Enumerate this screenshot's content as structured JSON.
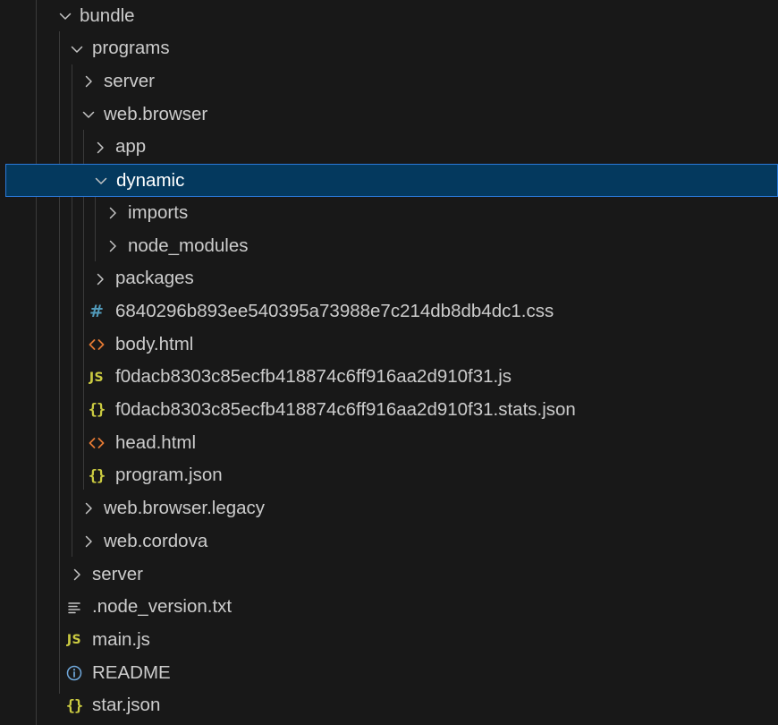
{
  "explorer": {
    "items": [
      {
        "label": "bundle",
        "kind": "folder",
        "expanded": true,
        "icon": "chevron-down-icon"
      },
      {
        "label": "programs",
        "kind": "folder",
        "expanded": true,
        "icon": "chevron-down-icon"
      },
      {
        "label": "server",
        "kind": "folder",
        "expanded": false,
        "icon": "chevron-right-icon"
      },
      {
        "label": "web.browser",
        "kind": "folder",
        "expanded": true,
        "icon": "chevron-down-icon"
      },
      {
        "label": "app",
        "kind": "folder",
        "expanded": false,
        "icon": "chevron-right-icon"
      },
      {
        "label": "dynamic",
        "kind": "folder",
        "expanded": true,
        "selected": true,
        "icon": "chevron-down-icon"
      },
      {
        "label": "imports",
        "kind": "folder",
        "expanded": false,
        "icon": "chevron-right-icon"
      },
      {
        "label": "node_modules",
        "kind": "folder",
        "expanded": false,
        "icon": "chevron-right-icon"
      },
      {
        "label": "packages",
        "kind": "folder",
        "expanded": false,
        "icon": "chevron-right-icon"
      },
      {
        "label": "6840296b893ee540395a73988e7c214db8db4dc1.css",
        "kind": "file",
        "icon": "css-hash-icon",
        "glyph": "#"
      },
      {
        "label": "body.html",
        "kind": "file",
        "icon": "html-brackets-icon"
      },
      {
        "label": "f0dacb8303c85ecfb418874c6ff916aa2d910f31.js",
        "kind": "file",
        "icon": "js-file-icon",
        "glyph": "JS"
      },
      {
        "label": "f0dacb8303c85ecfb418874c6ff916aa2d910f31.stats.json",
        "kind": "file",
        "icon": "json-braces-icon",
        "glyph": "{}"
      },
      {
        "label": "head.html",
        "kind": "file",
        "icon": "html-brackets-icon"
      },
      {
        "label": "program.json",
        "kind": "file",
        "icon": "json-braces-icon",
        "glyph": "{}"
      },
      {
        "label": "web.browser.legacy",
        "kind": "folder",
        "expanded": false,
        "icon": "chevron-right-icon"
      },
      {
        "label": "web.cordova",
        "kind": "folder",
        "expanded": false,
        "icon": "chevron-right-icon"
      },
      {
        "label": "server",
        "kind": "folder",
        "expanded": false,
        "icon": "chevron-right-icon"
      },
      {
        "label": ".node_version.txt",
        "kind": "file",
        "icon": "text-lines-icon"
      },
      {
        "label": "main.js",
        "kind": "file",
        "icon": "js-file-icon",
        "glyph": "JS"
      },
      {
        "label": "README",
        "kind": "file",
        "icon": "info-circle-icon"
      },
      {
        "label": "star.json",
        "kind": "file",
        "icon": "json-braces-icon",
        "glyph": "{}"
      }
    ]
  },
  "colors": {
    "background": "#181818",
    "text": "#cccccc",
    "selected_background": "#04395e",
    "selected_border": "#2b79d8",
    "js_yellow": "#cbcb41",
    "css_blue": "#519aba",
    "html_orange": "#e37933",
    "info_blue": "#6fa8dc"
  }
}
